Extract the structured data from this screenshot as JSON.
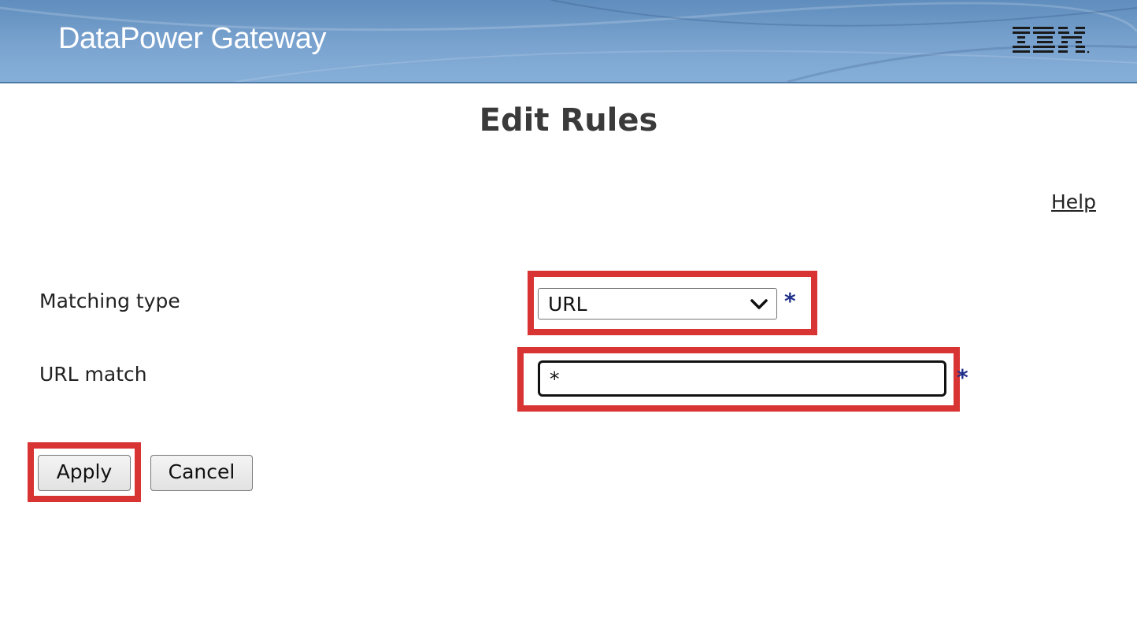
{
  "header": {
    "title": "DataPower Gateway",
    "logo": "IBM"
  },
  "page": {
    "title": "Edit Rules",
    "help_label": "Help"
  },
  "form": {
    "matching_type": {
      "label": "Matching type",
      "value": "URL",
      "required_marker": "*"
    },
    "url_match": {
      "label": "URL match",
      "value": "*",
      "required_marker": "*"
    }
  },
  "buttons": {
    "apply_label": "Apply",
    "cancel_label": "Cancel"
  },
  "colors": {
    "highlight": "#d93434",
    "required_star": "#1f2f8a",
    "banner": "#7aa3cf"
  }
}
